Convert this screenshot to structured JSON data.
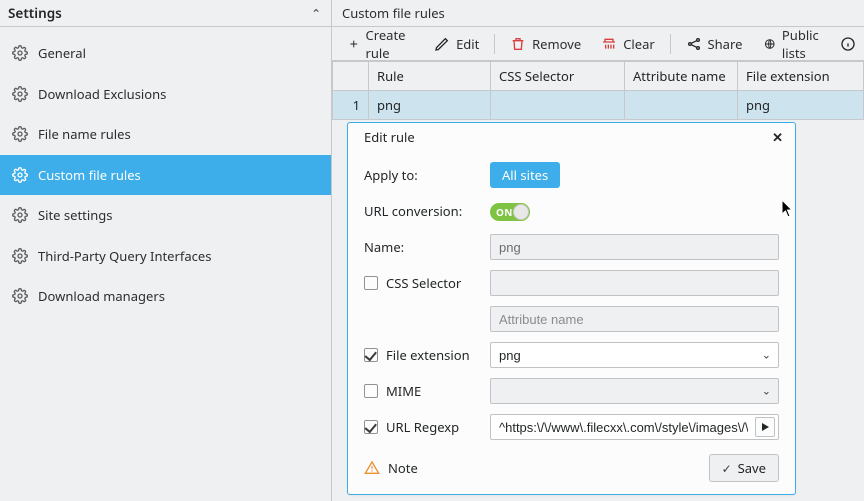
{
  "sidebar": {
    "title": "Settings",
    "items": [
      {
        "label": "General"
      },
      {
        "label": "Download Exclusions"
      },
      {
        "label": "File name rules"
      },
      {
        "label": "Custom file rules"
      },
      {
        "label": "Site settings"
      },
      {
        "label": "Third-Party Query Interfaces"
      },
      {
        "label": "Download managers"
      }
    ]
  },
  "main": {
    "title": "Custom file rules",
    "toolbar": {
      "create": "Create rule",
      "edit": "Edit",
      "remove": "Remove",
      "clear": "Clear",
      "share": "Share",
      "publiclists": "Public lists"
    },
    "table": {
      "headers": {
        "rule": "Rule",
        "css": "CSS Selector",
        "attr": "Attribute name",
        "ext": "File extension"
      },
      "rows": [
        {
          "num": "1",
          "rule": "png",
          "css": "",
          "attr": "",
          "ext": "png"
        }
      ]
    }
  },
  "dialog": {
    "title": "Edit rule",
    "labels": {
      "apply_to": "Apply to:",
      "url_conv": "URL conversion:",
      "name": "Name:",
      "css": "CSS Selector",
      "attr_placeholder": "Attribute name",
      "file_ext": "File extension",
      "mime": "MIME",
      "url_regexp": "URL Regexp",
      "note": "Note",
      "save": "Save"
    },
    "values": {
      "apply_to_btn": "All sites",
      "toggle_text": "ON",
      "name": "png",
      "css": "",
      "attr": "",
      "file_ext": "png",
      "mime": "",
      "url_regexp": "^https:\\/\\/www\\.filecxx\\.com\\/style\\/images\\/\\d+\\/"
    },
    "checks": {
      "css": false,
      "file_ext": true,
      "mime": false,
      "url_regexp": true
    }
  }
}
